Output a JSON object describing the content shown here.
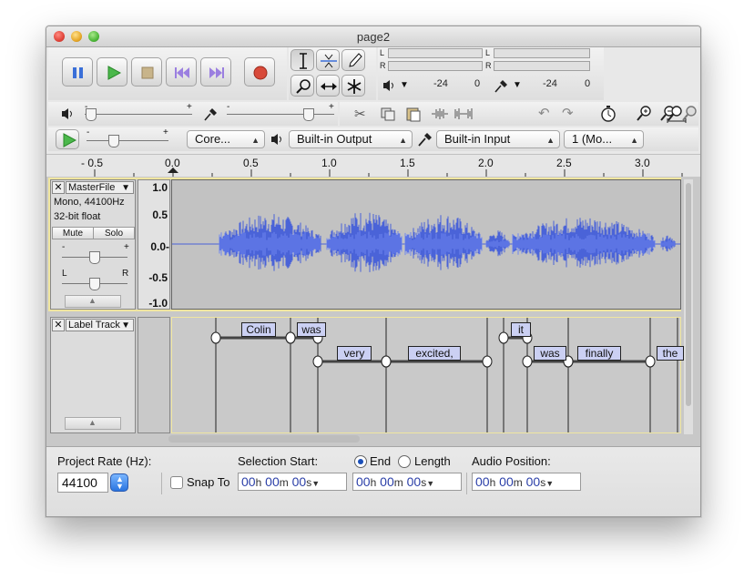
{
  "window": {
    "title": "page2"
  },
  "toolbar": {
    "transport": [
      "pause",
      "play",
      "stop",
      "skip-start",
      "skip-end",
      "record"
    ],
    "tools": [
      "selection-tool",
      "envelope-tool",
      "draw-tool",
      "zoom-tool",
      "timeshift-tool",
      "multi-tool"
    ],
    "meter": {
      "play_L": "L",
      "play_R": "R",
      "rec_L": "L",
      "rec_R": "R",
      "play_ticks": [
        "-24",
        "0"
      ],
      "rec_ticks": [
        "-24",
        "0"
      ]
    }
  },
  "device": {
    "host": "Core...",
    "output": "Built-in Output",
    "input": "Built-in Input",
    "channels": "1 (Mo..."
  },
  "ruler": {
    "ticks": [
      "- 0.5",
      "0.0",
      "0.5",
      "1.0",
      "1.5",
      "2.0",
      "2.5",
      "3.0"
    ]
  },
  "audio_track": {
    "name": "MasterFile",
    "info1": "Mono, 44100Hz",
    "info2": "32-bit float",
    "mute": "Mute",
    "solo": "Solo",
    "gain_minus": "-",
    "gain_plus": "+",
    "pan_left": "L",
    "pan_right": "R",
    "vruler": [
      "1.0",
      "0.5",
      "0.0-",
      "-0.5",
      "-1.0"
    ]
  },
  "label_track": {
    "name": "Label Track",
    "labels": [
      "Colin",
      "was",
      "very",
      "excited,",
      "it",
      "was",
      "finally",
      "the"
    ]
  },
  "bottom": {
    "project_rate_label": "Project Rate (Hz):",
    "project_rate": "44100",
    "snap_to": "Snap To",
    "selection_start_label": "Selection Start:",
    "end_label": "End",
    "length_label": "Length",
    "audio_position_label": "Audio Position:",
    "time_units": {
      "h": "h",
      "m": "m",
      "s": "s"
    },
    "time_values": {
      "hours": "00",
      "minutes": "00",
      "seconds": "00"
    }
  }
}
